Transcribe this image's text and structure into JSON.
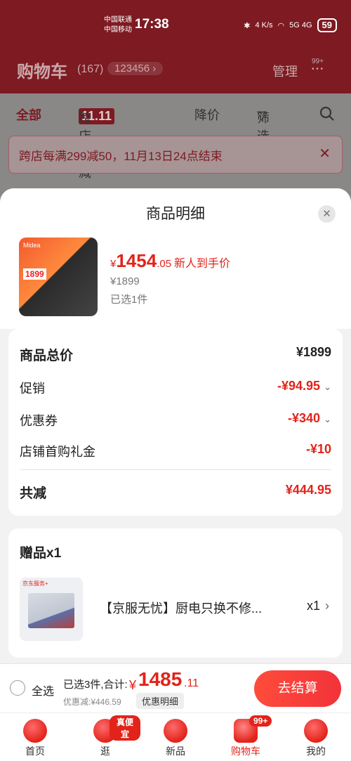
{
  "status_bar": {
    "carrier1": "中国联通",
    "carrier2": "中国移动",
    "time": "17:38",
    "speed": "4 K/s",
    "network": "5G 4G",
    "battery": "59"
  },
  "cart_header": {
    "title": "购物车",
    "count": "(167)",
    "address": "123456 ›",
    "manage": "管理",
    "more_badge": "99+"
  },
  "filters": {
    "all": "全部",
    "cross_store_badge": "11.11",
    "cross_store": "跨店满减",
    "price_drop": "降价",
    "filter": "筛选",
    "search_icon": "search-icon"
  },
  "promo_banner": {
    "text": "跨店每满299减50，11月13日24点结束"
  },
  "sheet": {
    "title": "商品明细",
    "product": {
      "image_brand": "Midea",
      "image_tag": "1899",
      "yen": "¥",
      "price_int": "1454",
      "price_dec": ".05",
      "price_tag": "新人到手价",
      "original_price": "¥1899",
      "selected": "已选1件"
    },
    "price_breakdown": {
      "total_label": "商品总价",
      "total_value": "¥1899",
      "promo_label": "促销",
      "promo_value": "-¥94.95",
      "coupon_label": "优惠券",
      "coupon_value": "-¥340",
      "gift_money_label": "店铺首购礼金",
      "gift_money_value": "-¥10",
      "saved_label": "共减",
      "saved_value": "¥444.95"
    },
    "gift": {
      "title": "赠品x1",
      "image_brand": "京东服务+",
      "name": "【京服无忧】厨电只换不修...",
      "qty": "x1",
      "arrow": "›"
    }
  },
  "checkout": {
    "select_all": "全选",
    "summary": "已选3件,合计:",
    "yen": "¥",
    "total_int": "1485",
    "total_dec": ".11",
    "discount": "优惠减:¥446.59",
    "detail_button": "优惠明细",
    "checkout_button": "去结算"
  },
  "nav": [
    {
      "label": "首页",
      "icon": "home-icon"
    },
    {
      "label": "逛",
      "icon": "browse-icon",
      "badge": "真便宜"
    },
    {
      "label": "新品",
      "icon": "new-product-icon"
    },
    {
      "label": "购物车",
      "icon": "cart-icon",
      "badge": "99+"
    },
    {
      "label": "我的",
      "icon": "profile-icon"
    }
  ],
  "colors": {
    "accent": "#e2231a",
    "header_dim": "#7d1a22"
  }
}
